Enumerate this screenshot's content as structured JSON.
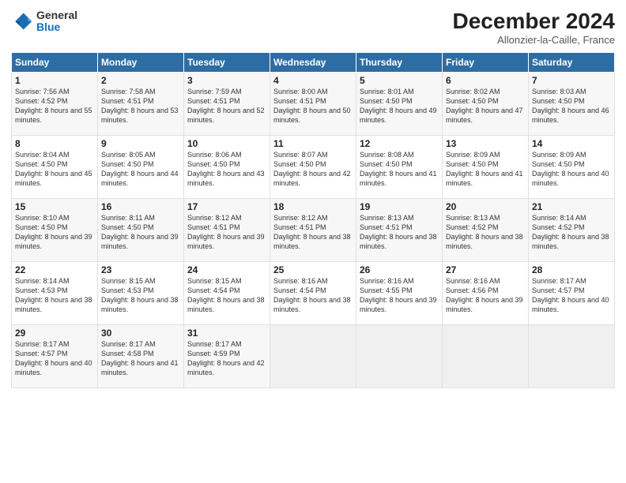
{
  "header": {
    "logo_general": "General",
    "logo_blue": "Blue",
    "month_title": "December 2024",
    "location": "Allonzier-la-Caille, France"
  },
  "days_of_week": [
    "Sunday",
    "Monday",
    "Tuesday",
    "Wednesday",
    "Thursday",
    "Friday",
    "Saturday"
  ],
  "weeks": [
    [
      {
        "day": "1",
        "sunrise": "Sunrise: 7:56 AM",
        "sunset": "Sunset: 4:52 PM",
        "daylight": "Daylight: 8 hours and 55 minutes."
      },
      {
        "day": "2",
        "sunrise": "Sunrise: 7:58 AM",
        "sunset": "Sunset: 4:51 PM",
        "daylight": "Daylight: 8 hours and 53 minutes."
      },
      {
        "day": "3",
        "sunrise": "Sunrise: 7:59 AM",
        "sunset": "Sunset: 4:51 PM",
        "daylight": "Daylight: 8 hours and 52 minutes."
      },
      {
        "day": "4",
        "sunrise": "Sunrise: 8:00 AM",
        "sunset": "Sunset: 4:51 PM",
        "daylight": "Daylight: 8 hours and 50 minutes."
      },
      {
        "day": "5",
        "sunrise": "Sunrise: 8:01 AM",
        "sunset": "Sunset: 4:50 PM",
        "daylight": "Daylight: 8 hours and 49 minutes."
      },
      {
        "day": "6",
        "sunrise": "Sunrise: 8:02 AM",
        "sunset": "Sunset: 4:50 PM",
        "daylight": "Daylight: 8 hours and 47 minutes."
      },
      {
        "day": "7",
        "sunrise": "Sunrise: 8:03 AM",
        "sunset": "Sunset: 4:50 PM",
        "daylight": "Daylight: 8 hours and 46 minutes."
      }
    ],
    [
      {
        "day": "8",
        "sunrise": "Sunrise: 8:04 AM",
        "sunset": "Sunset: 4:50 PM",
        "daylight": "Daylight: 8 hours and 45 minutes."
      },
      {
        "day": "9",
        "sunrise": "Sunrise: 8:05 AM",
        "sunset": "Sunset: 4:50 PM",
        "daylight": "Daylight: 8 hours and 44 minutes."
      },
      {
        "day": "10",
        "sunrise": "Sunrise: 8:06 AM",
        "sunset": "Sunset: 4:50 PM",
        "daylight": "Daylight: 8 hours and 43 minutes."
      },
      {
        "day": "11",
        "sunrise": "Sunrise: 8:07 AM",
        "sunset": "Sunset: 4:50 PM",
        "daylight": "Daylight: 8 hours and 42 minutes."
      },
      {
        "day": "12",
        "sunrise": "Sunrise: 8:08 AM",
        "sunset": "Sunset: 4:50 PM",
        "daylight": "Daylight: 8 hours and 41 minutes."
      },
      {
        "day": "13",
        "sunrise": "Sunrise: 8:09 AM",
        "sunset": "Sunset: 4:50 PM",
        "daylight": "Daylight: 8 hours and 41 minutes."
      },
      {
        "day": "14",
        "sunrise": "Sunrise: 8:09 AM",
        "sunset": "Sunset: 4:50 PM",
        "daylight": "Daylight: 8 hours and 40 minutes."
      }
    ],
    [
      {
        "day": "15",
        "sunrise": "Sunrise: 8:10 AM",
        "sunset": "Sunset: 4:50 PM",
        "daylight": "Daylight: 8 hours and 39 minutes."
      },
      {
        "day": "16",
        "sunrise": "Sunrise: 8:11 AM",
        "sunset": "Sunset: 4:50 PM",
        "daylight": "Daylight: 8 hours and 39 minutes."
      },
      {
        "day": "17",
        "sunrise": "Sunrise: 8:12 AM",
        "sunset": "Sunset: 4:51 PM",
        "daylight": "Daylight: 8 hours and 39 minutes."
      },
      {
        "day": "18",
        "sunrise": "Sunrise: 8:12 AM",
        "sunset": "Sunset: 4:51 PM",
        "daylight": "Daylight: 8 hours and 38 minutes."
      },
      {
        "day": "19",
        "sunrise": "Sunrise: 8:13 AM",
        "sunset": "Sunset: 4:51 PM",
        "daylight": "Daylight: 8 hours and 38 minutes."
      },
      {
        "day": "20",
        "sunrise": "Sunrise: 8:13 AM",
        "sunset": "Sunset: 4:52 PM",
        "daylight": "Daylight: 8 hours and 38 minutes."
      },
      {
        "day": "21",
        "sunrise": "Sunrise: 8:14 AM",
        "sunset": "Sunset: 4:52 PM",
        "daylight": "Daylight: 8 hours and 38 minutes."
      }
    ],
    [
      {
        "day": "22",
        "sunrise": "Sunrise: 8:14 AM",
        "sunset": "Sunset: 4:53 PM",
        "daylight": "Daylight: 8 hours and 38 minutes."
      },
      {
        "day": "23",
        "sunrise": "Sunrise: 8:15 AM",
        "sunset": "Sunset: 4:53 PM",
        "daylight": "Daylight: 8 hours and 38 minutes."
      },
      {
        "day": "24",
        "sunrise": "Sunrise: 8:15 AM",
        "sunset": "Sunset: 4:54 PM",
        "daylight": "Daylight: 8 hours and 38 minutes."
      },
      {
        "day": "25",
        "sunrise": "Sunrise: 8:16 AM",
        "sunset": "Sunset: 4:54 PM",
        "daylight": "Daylight: 8 hours and 38 minutes."
      },
      {
        "day": "26",
        "sunrise": "Sunrise: 8:16 AM",
        "sunset": "Sunset: 4:55 PM",
        "daylight": "Daylight: 8 hours and 39 minutes."
      },
      {
        "day": "27",
        "sunrise": "Sunrise: 8:16 AM",
        "sunset": "Sunset: 4:56 PM",
        "daylight": "Daylight: 8 hours and 39 minutes."
      },
      {
        "day": "28",
        "sunrise": "Sunrise: 8:17 AM",
        "sunset": "Sunset: 4:57 PM",
        "daylight": "Daylight: 8 hours and 40 minutes."
      }
    ],
    [
      {
        "day": "29",
        "sunrise": "Sunrise: 8:17 AM",
        "sunset": "Sunset: 4:57 PM",
        "daylight": "Daylight: 8 hours and 40 minutes."
      },
      {
        "day": "30",
        "sunrise": "Sunrise: 8:17 AM",
        "sunset": "Sunset: 4:58 PM",
        "daylight": "Daylight: 8 hours and 41 minutes."
      },
      {
        "day": "31",
        "sunrise": "Sunrise: 8:17 AM",
        "sunset": "Sunset: 4:59 PM",
        "daylight": "Daylight: 8 hours and 42 minutes."
      },
      null,
      null,
      null,
      null
    ]
  ]
}
